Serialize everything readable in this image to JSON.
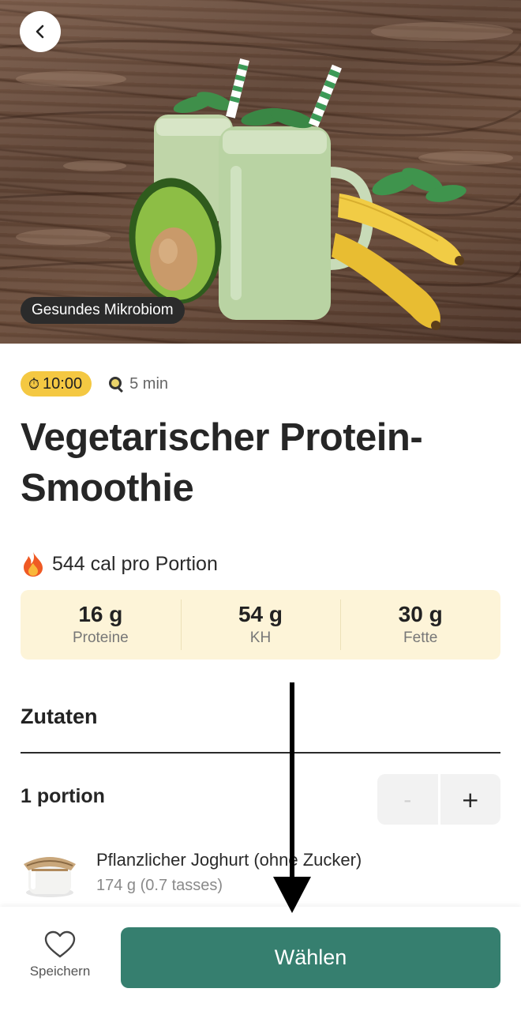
{
  "hero": {
    "tag": "Gesundes Mikrobiom",
    "image_description_icon": "smoothie-photo"
  },
  "meta": {
    "timer": "10:00",
    "cook_time": "5 min"
  },
  "recipe": {
    "title": "Vegetarischer Protein-Smoothie"
  },
  "nutrition": {
    "calories_text": "544 cal pro Portion",
    "macros": [
      {
        "value": "16 g",
        "label": "Proteine"
      },
      {
        "value": "54 g",
        "label": "KH"
      },
      {
        "value": "30 g",
        "label": "Fette"
      }
    ]
  },
  "ingredients_section": {
    "title": "Zutaten",
    "portion_label": "1 portion",
    "minus": "-",
    "plus": "+",
    "items": [
      {
        "name": "Pflanzlicher Joghurt (ohne Zucker)",
        "amount": "174 g (0.7 tasses)"
      }
    ]
  },
  "bottom_bar": {
    "save_label": "Speichern",
    "choose_label": "Wählen"
  },
  "colors": {
    "accent": "#367f6f",
    "timer_badge": "#f4c842",
    "macro_bg": "#fdf4d8"
  }
}
